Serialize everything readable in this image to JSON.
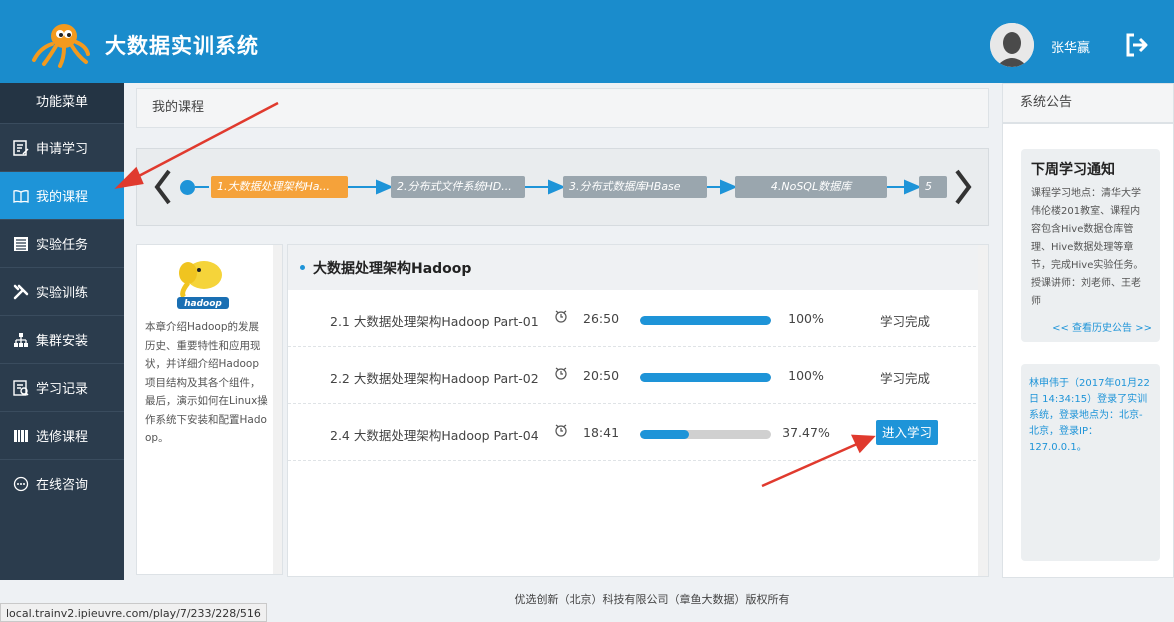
{
  "header": {
    "title": "大数据实训系统",
    "user_name": "张华赢",
    "accent": "#1a8ccc"
  },
  "sidebar": {
    "heading": "功能菜单",
    "items": [
      {
        "label": "申请学习",
        "icon": "apply-icon"
      },
      {
        "label": "我的课程",
        "icon": "book-icon",
        "active": true
      },
      {
        "label": "实验任务",
        "icon": "task-list-icon"
      },
      {
        "label": "实验训练",
        "icon": "tools-icon"
      },
      {
        "label": "集群安装",
        "icon": "cluster-icon"
      },
      {
        "label": "学习记录",
        "icon": "record-icon"
      },
      {
        "label": "选修课程",
        "icon": "elective-icon"
      },
      {
        "label": "在线咨询",
        "icon": "chat-icon"
      }
    ]
  },
  "breadcrumb": "我的课程",
  "steps": [
    {
      "label": "1.大数据处理架构Ha...",
      "state": "current"
    },
    {
      "label": "2.分布式文件系统HD...",
      "state": "todo"
    },
    {
      "label": "3.分布式数据库HBase",
      "state": "todo"
    },
    {
      "label": "4.NoSQL数据库",
      "state": "todo"
    },
    {
      "label": "5",
      "state": "todo"
    }
  ],
  "intro": {
    "logo_text": "hadoop",
    "text": "本章介绍Hadoop的发展历史、重要特性和应用现状，并详细介绍Hadoop项目结构及其各个组件，最后，演示如何在Linux操作系统下安装和配置Hadoop。"
  },
  "chapter": {
    "title": "大数据处理架构Hadoop",
    "lessons": [
      {
        "title": "2.1 大数据处理架构Hadoop Part-01",
        "duration": "26:50",
        "progress": 1.0,
        "percent": "100%",
        "status": "学习完成"
      },
      {
        "title": "2.2 大数据处理架构Hadoop Part-02",
        "duration": "20:50",
        "progress": 1.0,
        "percent": "100%",
        "status": "学习完成"
      },
      {
        "title": "2.4 大数据处理架构Hadoop Part-04",
        "duration": "18:41",
        "progress": 0.3747,
        "percent": "37.47%",
        "action": "进入学习"
      }
    ]
  },
  "notice": {
    "heading": "系统公告",
    "title": "下周学习通知",
    "body": "课程学习地点：清华大学伟伦楼201教室、课程内容包含Hive数据仓库管理、Hive数据处理等章节，完成Hive实验任务。授课讲师：刘老师、王老师",
    "more": "<< 查看历史公告 >>",
    "log": "林申伟于（2017年01月22日 14:34:15）登录了实训系统，登录地点为：北京-北京，登录IP：127.0.0.1。"
  },
  "footer": "优选创新（北京）科技有限公司（章鱼大数据）版权所有",
  "status_url": "local.trainv2.ipieuvre.com/play/7/233/228/516"
}
